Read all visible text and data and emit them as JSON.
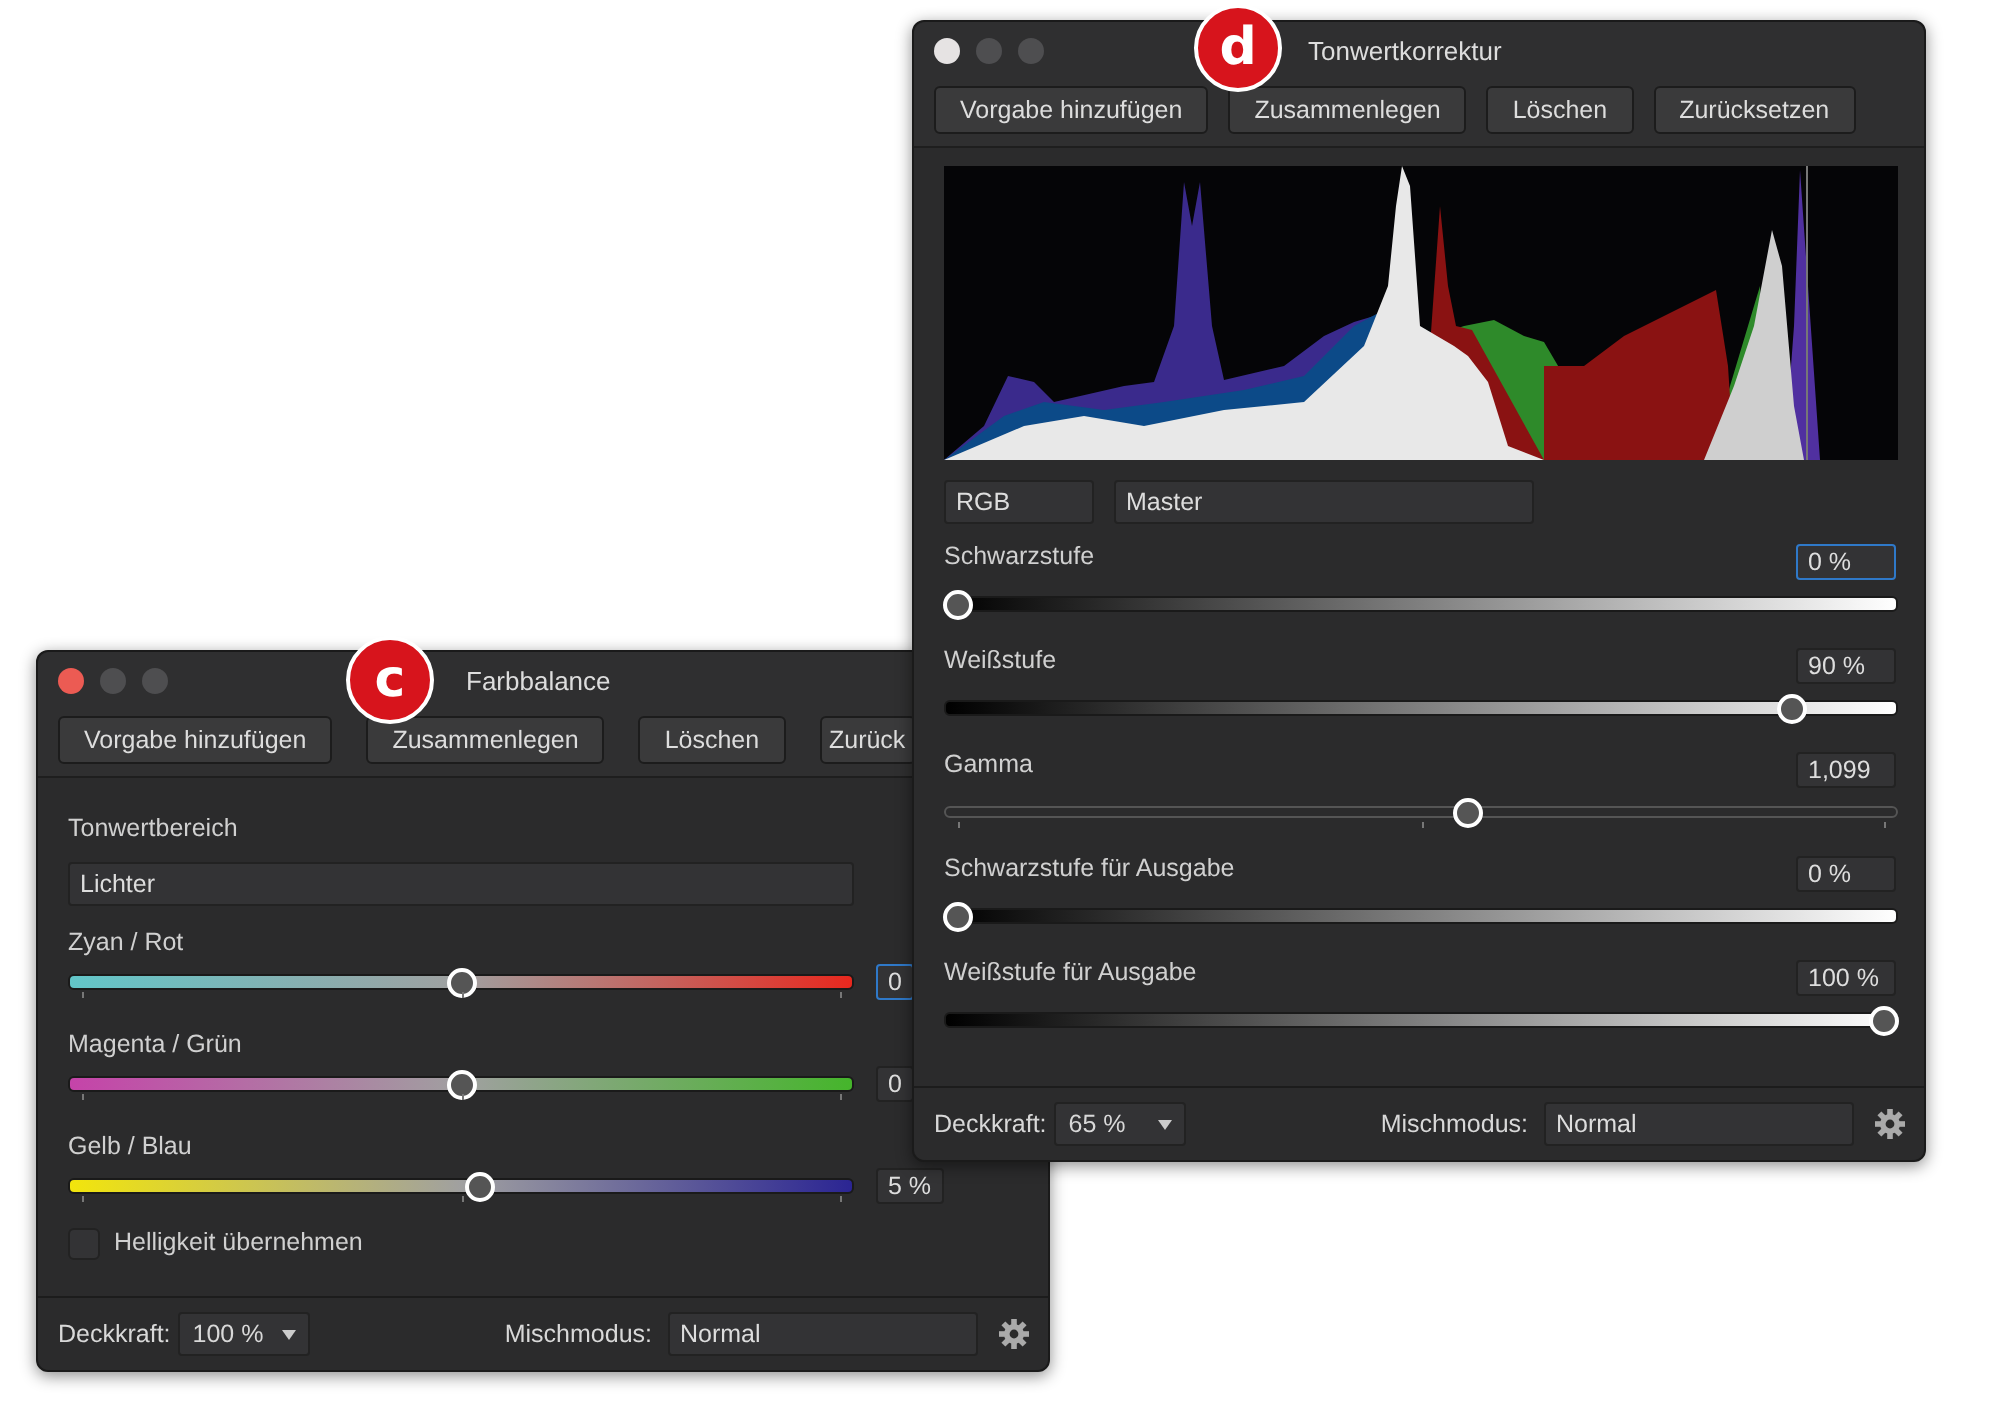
{
  "levels_window": {
    "title": "Tonwertkorrektur",
    "callout": "d",
    "focused": false,
    "buttons": [
      "Vorgabe hinzufügen",
      "Zusammenlegen",
      "Löschen",
      "Zurücksetzen"
    ],
    "channel": "RGB",
    "target": "Master",
    "sliders": [
      {
        "label": "Schwarzstufe",
        "value": "0 %",
        "level": 0.0,
        "kind": "ramp",
        "focused": true
      },
      {
        "label": "Weißstufe",
        "value": "90 %",
        "level": 0.9,
        "kind": "ramp",
        "focused": false
      },
      {
        "label": "Gamma",
        "value": "1,099",
        "level": 0.55,
        "kind": "thin",
        "focused": false
      },
      {
        "label": "Schwarzstufe für Ausgabe",
        "value": "0 %",
        "level": 0.0,
        "kind": "ramp",
        "focused": false
      },
      {
        "label": "Weißstufe für Ausgabe",
        "value": "100 %",
        "level": 1.0,
        "kind": "ramp",
        "focused": false
      }
    ],
    "footer": {
      "opacity_label": "Deckkraft:",
      "opacity": "65 %",
      "blend_label": "Mischmodus:",
      "blend": "Normal"
    }
  },
  "color_balance_window": {
    "title": "Farbbalance",
    "callout": "c",
    "focused": true,
    "buttons": [
      "Vorgabe hinzufügen",
      "Zusammenlegen",
      "Löschen",
      "Zurück"
    ],
    "range_label": "Tonwertbereich",
    "range": "Lichter",
    "sliders": [
      {
        "label": "Zyan / Rot",
        "value": "0",
        "level": 0.5,
        "kind": "cyan-red",
        "focused": true
      },
      {
        "label": "Magenta / Grün",
        "value": "0",
        "level": 0.5,
        "kind": "magenta-green",
        "focused": false
      },
      {
        "label": "Gelb / Blau",
        "value": "5 %",
        "level": 0.525,
        "kind": "yellow-blue",
        "focused": false
      }
    ],
    "checkbox": {
      "label": "Helligkeit übernehmen",
      "checked": false
    },
    "footer": {
      "opacity_label": "Deckkraft:",
      "opacity": "100 %",
      "blend_label": "Mischmodus:",
      "blend": "Normal"
    }
  }
}
